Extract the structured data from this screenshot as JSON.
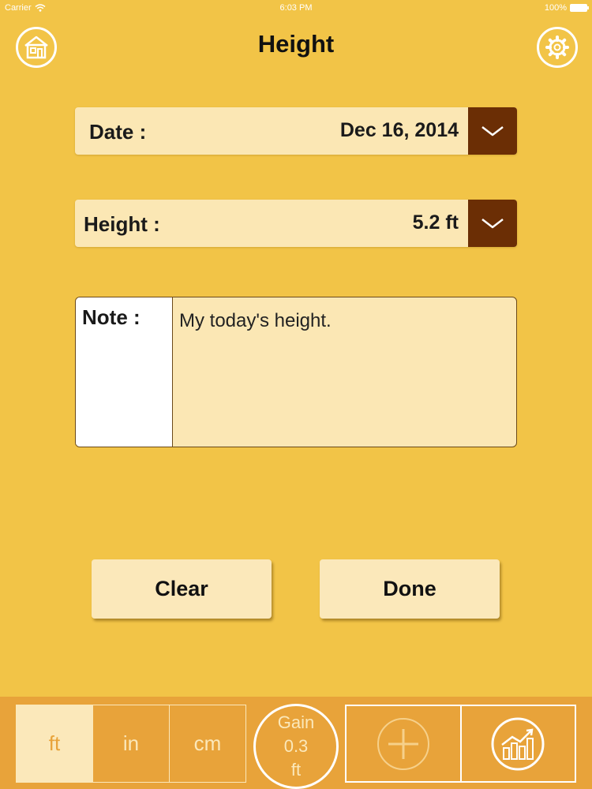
{
  "status_bar": {
    "carrier": "Carrier",
    "time": "6:03 PM",
    "battery": "100%"
  },
  "header": {
    "title": "Height",
    "home_icon": "home-icon",
    "settings_icon": "gear-icon"
  },
  "form": {
    "date_label": "Date :",
    "date_value": "Dec 16, 2014",
    "height_label": "Height :",
    "height_value": "5.2 ft",
    "note_label": "Note :",
    "note_text": "My today's height."
  },
  "actions": {
    "clear_label": "Clear",
    "done_label": "Done"
  },
  "toolbar": {
    "units": [
      {
        "label": "ft",
        "selected": true
      },
      {
        "label": "in",
        "selected": false
      },
      {
        "label": "cm",
        "selected": false
      }
    ],
    "gain_label": "Gain",
    "gain_value": "0.3",
    "gain_unit": "ft",
    "add_icon": "plus-icon",
    "chart_icon": "growth-chart-icon"
  },
  "colors": {
    "background": "#F2C447",
    "field_bg": "#FBE7B4",
    "dropdown": "#6B2E05",
    "toolbar": "#E8A33A"
  }
}
